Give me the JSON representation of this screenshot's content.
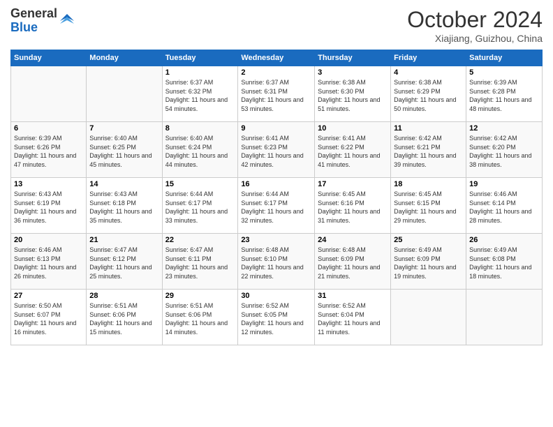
{
  "logo": {
    "general": "General",
    "blue": "Blue"
  },
  "title": "October 2024",
  "location": "Xiajiang, Guizhou, China",
  "days_of_week": [
    "Sunday",
    "Monday",
    "Tuesday",
    "Wednesday",
    "Thursday",
    "Friday",
    "Saturday"
  ],
  "weeks": [
    [
      {
        "day": "",
        "sunrise": "",
        "sunset": "",
        "daylight": ""
      },
      {
        "day": "",
        "sunrise": "",
        "sunset": "",
        "daylight": ""
      },
      {
        "day": "1",
        "sunrise": "Sunrise: 6:37 AM",
        "sunset": "Sunset: 6:32 PM",
        "daylight": "Daylight: 11 hours and 54 minutes."
      },
      {
        "day": "2",
        "sunrise": "Sunrise: 6:37 AM",
        "sunset": "Sunset: 6:31 PM",
        "daylight": "Daylight: 11 hours and 53 minutes."
      },
      {
        "day": "3",
        "sunrise": "Sunrise: 6:38 AM",
        "sunset": "Sunset: 6:30 PM",
        "daylight": "Daylight: 11 hours and 51 minutes."
      },
      {
        "day": "4",
        "sunrise": "Sunrise: 6:38 AM",
        "sunset": "Sunset: 6:29 PM",
        "daylight": "Daylight: 11 hours and 50 minutes."
      },
      {
        "day": "5",
        "sunrise": "Sunrise: 6:39 AM",
        "sunset": "Sunset: 6:28 PM",
        "daylight": "Daylight: 11 hours and 48 minutes."
      }
    ],
    [
      {
        "day": "6",
        "sunrise": "Sunrise: 6:39 AM",
        "sunset": "Sunset: 6:26 PM",
        "daylight": "Daylight: 11 hours and 47 minutes."
      },
      {
        "day": "7",
        "sunrise": "Sunrise: 6:40 AM",
        "sunset": "Sunset: 6:25 PM",
        "daylight": "Daylight: 11 hours and 45 minutes."
      },
      {
        "day": "8",
        "sunrise": "Sunrise: 6:40 AM",
        "sunset": "Sunset: 6:24 PM",
        "daylight": "Daylight: 11 hours and 44 minutes."
      },
      {
        "day": "9",
        "sunrise": "Sunrise: 6:41 AM",
        "sunset": "Sunset: 6:23 PM",
        "daylight": "Daylight: 11 hours and 42 minutes."
      },
      {
        "day": "10",
        "sunrise": "Sunrise: 6:41 AM",
        "sunset": "Sunset: 6:22 PM",
        "daylight": "Daylight: 11 hours and 41 minutes."
      },
      {
        "day": "11",
        "sunrise": "Sunrise: 6:42 AM",
        "sunset": "Sunset: 6:21 PM",
        "daylight": "Daylight: 11 hours and 39 minutes."
      },
      {
        "day": "12",
        "sunrise": "Sunrise: 6:42 AM",
        "sunset": "Sunset: 6:20 PM",
        "daylight": "Daylight: 11 hours and 38 minutes."
      }
    ],
    [
      {
        "day": "13",
        "sunrise": "Sunrise: 6:43 AM",
        "sunset": "Sunset: 6:19 PM",
        "daylight": "Daylight: 11 hours and 36 minutes."
      },
      {
        "day": "14",
        "sunrise": "Sunrise: 6:43 AM",
        "sunset": "Sunset: 6:18 PM",
        "daylight": "Daylight: 11 hours and 35 minutes."
      },
      {
        "day": "15",
        "sunrise": "Sunrise: 6:44 AM",
        "sunset": "Sunset: 6:17 PM",
        "daylight": "Daylight: 11 hours and 33 minutes."
      },
      {
        "day": "16",
        "sunrise": "Sunrise: 6:44 AM",
        "sunset": "Sunset: 6:17 PM",
        "daylight": "Daylight: 11 hours and 32 minutes."
      },
      {
        "day": "17",
        "sunrise": "Sunrise: 6:45 AM",
        "sunset": "Sunset: 6:16 PM",
        "daylight": "Daylight: 11 hours and 31 minutes."
      },
      {
        "day": "18",
        "sunrise": "Sunrise: 6:45 AM",
        "sunset": "Sunset: 6:15 PM",
        "daylight": "Daylight: 11 hours and 29 minutes."
      },
      {
        "day": "19",
        "sunrise": "Sunrise: 6:46 AM",
        "sunset": "Sunset: 6:14 PM",
        "daylight": "Daylight: 11 hours and 28 minutes."
      }
    ],
    [
      {
        "day": "20",
        "sunrise": "Sunrise: 6:46 AM",
        "sunset": "Sunset: 6:13 PM",
        "daylight": "Daylight: 11 hours and 26 minutes."
      },
      {
        "day": "21",
        "sunrise": "Sunrise: 6:47 AM",
        "sunset": "Sunset: 6:12 PM",
        "daylight": "Daylight: 11 hours and 25 minutes."
      },
      {
        "day": "22",
        "sunrise": "Sunrise: 6:47 AM",
        "sunset": "Sunset: 6:11 PM",
        "daylight": "Daylight: 11 hours and 23 minutes."
      },
      {
        "day": "23",
        "sunrise": "Sunrise: 6:48 AM",
        "sunset": "Sunset: 6:10 PM",
        "daylight": "Daylight: 11 hours and 22 minutes."
      },
      {
        "day": "24",
        "sunrise": "Sunrise: 6:48 AM",
        "sunset": "Sunset: 6:09 PM",
        "daylight": "Daylight: 11 hours and 21 minutes."
      },
      {
        "day": "25",
        "sunrise": "Sunrise: 6:49 AM",
        "sunset": "Sunset: 6:09 PM",
        "daylight": "Daylight: 11 hours and 19 minutes."
      },
      {
        "day": "26",
        "sunrise": "Sunrise: 6:49 AM",
        "sunset": "Sunset: 6:08 PM",
        "daylight": "Daylight: 11 hours and 18 minutes."
      }
    ],
    [
      {
        "day": "27",
        "sunrise": "Sunrise: 6:50 AM",
        "sunset": "Sunset: 6:07 PM",
        "daylight": "Daylight: 11 hours and 16 minutes."
      },
      {
        "day": "28",
        "sunrise": "Sunrise: 6:51 AM",
        "sunset": "Sunset: 6:06 PM",
        "daylight": "Daylight: 11 hours and 15 minutes."
      },
      {
        "day": "29",
        "sunrise": "Sunrise: 6:51 AM",
        "sunset": "Sunset: 6:06 PM",
        "daylight": "Daylight: 11 hours and 14 minutes."
      },
      {
        "day": "30",
        "sunrise": "Sunrise: 6:52 AM",
        "sunset": "Sunset: 6:05 PM",
        "daylight": "Daylight: 11 hours and 12 minutes."
      },
      {
        "day": "31",
        "sunrise": "Sunrise: 6:52 AM",
        "sunset": "Sunset: 6:04 PM",
        "daylight": "Daylight: 11 hours and 11 minutes."
      },
      {
        "day": "",
        "sunrise": "",
        "sunset": "",
        "daylight": ""
      },
      {
        "day": "",
        "sunrise": "",
        "sunset": "",
        "daylight": ""
      }
    ]
  ]
}
